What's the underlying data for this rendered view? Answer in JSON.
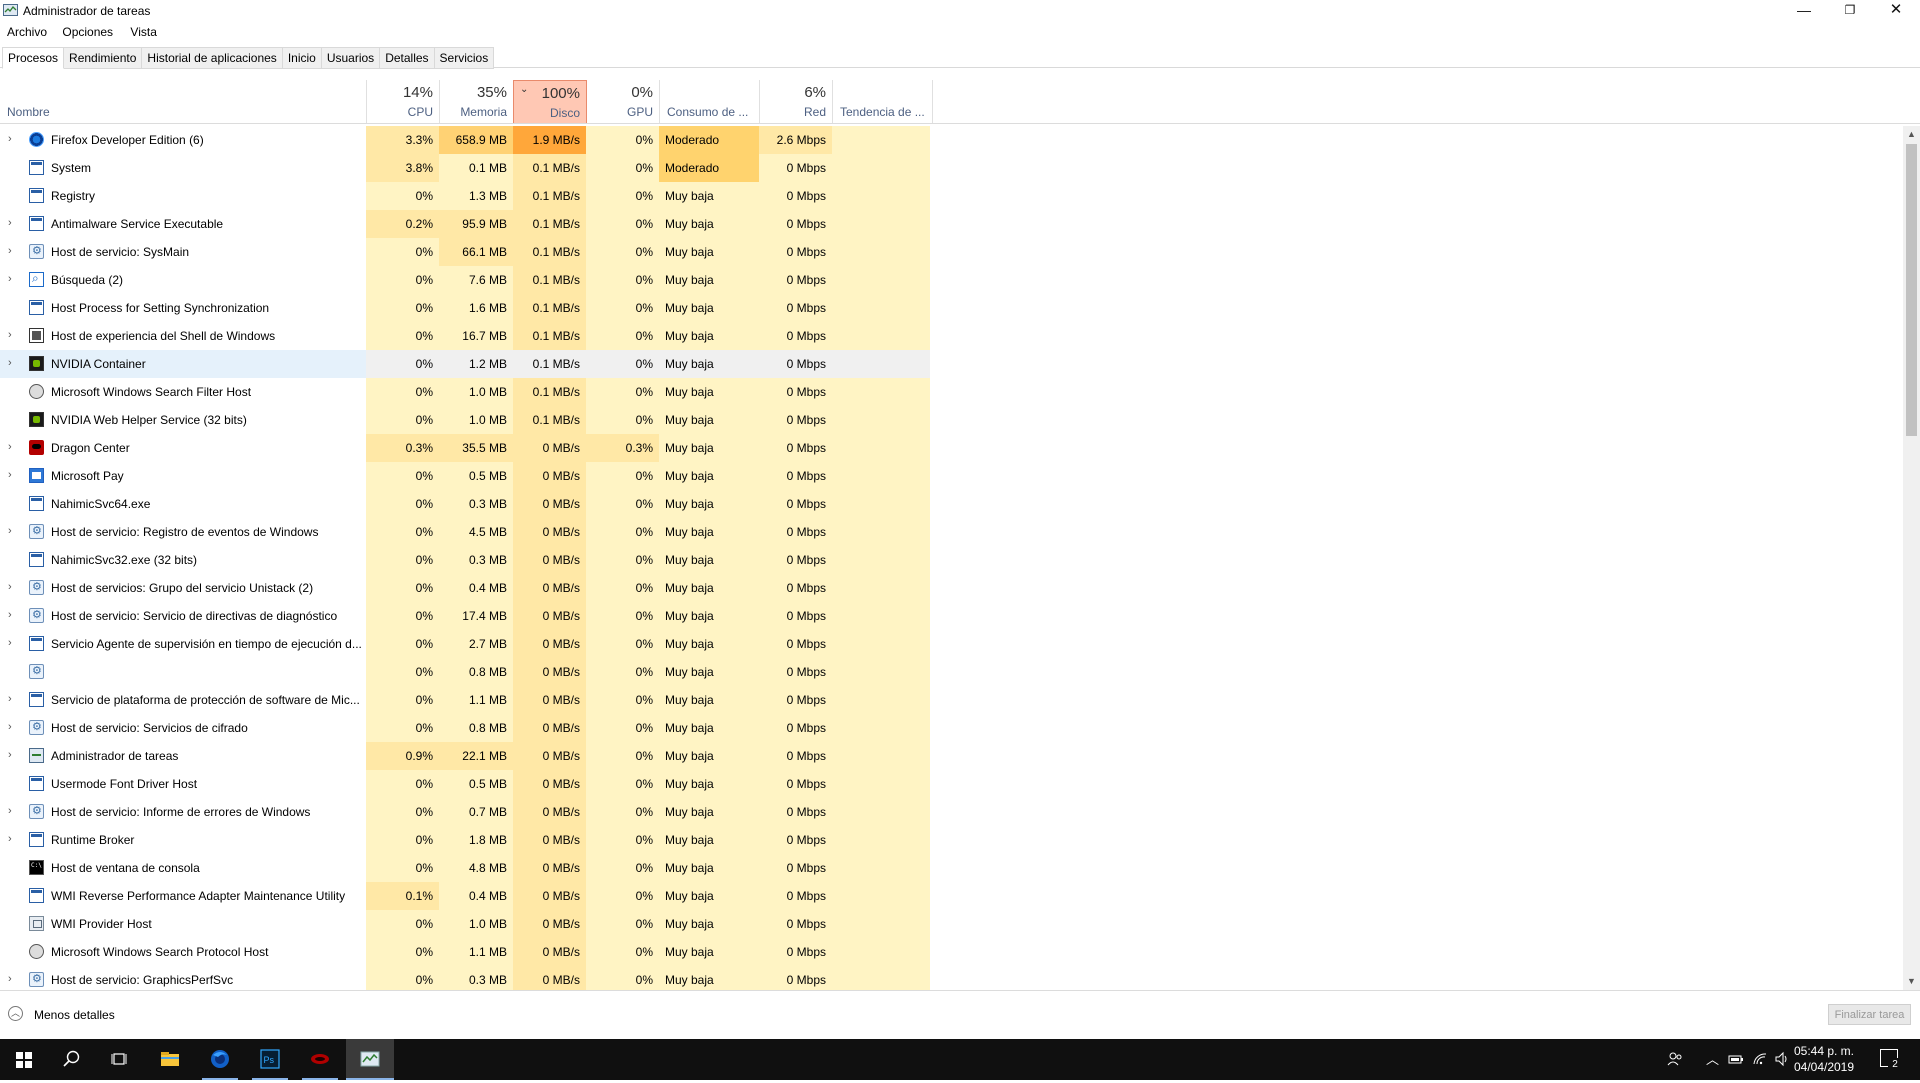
{
  "window": {
    "title": "Administrador de tareas",
    "min_glyph": "—",
    "max_glyph": "❐",
    "close_glyph": "✕"
  },
  "menu": [
    "Archivo",
    "Opciones",
    "Vista"
  ],
  "tabs": [
    "Procesos",
    "Rendimiento",
    "Historial de aplicaciones",
    "Inicio",
    "Usuarios",
    "Detalles",
    "Servicios"
  ],
  "active_tab": "Procesos",
  "columns": {
    "name": {
      "label": "Nombre"
    },
    "cpu": {
      "pct": "14%",
      "label": "CPU"
    },
    "memory": {
      "pct": "35%",
      "label": "Memoria"
    },
    "disk": {
      "pct": "100%",
      "label": "Disco",
      "sorted": "descending"
    },
    "gpu": {
      "pct": "0%",
      "label": "GPU"
    },
    "power": {
      "label": "Consumo de ..."
    },
    "network": {
      "pct": "6%",
      "label": "Red"
    },
    "trend": {
      "label": "Tendencia de ..."
    }
  },
  "processes": [
    {
      "name": "Firefox Developer Edition (6)",
      "icon": "firefox-icon",
      "expandable": true,
      "cpu": "3.3%",
      "mem": "658.9 MB",
      "disk": "1.9 MB/s",
      "gpu": "0%",
      "power": "Moderado",
      "net": "2.6 Mbps"
    },
    {
      "name": "System",
      "icon": "window-icon",
      "expandable": false,
      "cpu": "3.8%",
      "mem": "0.1 MB",
      "disk": "0.1 MB/s",
      "gpu": "0%",
      "power": "Moderado",
      "net": "0 Mbps"
    },
    {
      "name": "Registry",
      "icon": "window-icon",
      "expandable": false,
      "cpu": "0%",
      "mem": "1.3 MB",
      "disk": "0.1 MB/s",
      "gpu": "0%",
      "power": "Muy baja",
      "net": "0 Mbps"
    },
    {
      "name": "Antimalware Service Executable",
      "icon": "window-icon",
      "expandable": true,
      "cpu": "0.2%",
      "mem": "95.9 MB",
      "disk": "0.1 MB/s",
      "gpu": "0%",
      "power": "Muy baja",
      "net": "0 Mbps"
    },
    {
      "name": "Host de servicio: SysMain",
      "icon": "gear-icon",
      "expandable": true,
      "cpu": "0%",
      "mem": "66.1 MB",
      "disk": "0.1 MB/s",
      "gpu": "0%",
      "power": "Muy baja",
      "net": "0 Mbps"
    },
    {
      "name": "Búsqueda (2)",
      "icon": "search-icon",
      "expandable": true,
      "cpu": "0%",
      "mem": "7.6 MB",
      "disk": "0.1 MB/s",
      "gpu": "0%",
      "power": "Muy baja",
      "net": "0 Mbps"
    },
    {
      "name": "Host Process for Setting Synchronization",
      "icon": "window-icon",
      "expandable": false,
      "cpu": "0%",
      "mem": "1.6 MB",
      "disk": "0.1 MB/s",
      "gpu": "0%",
      "power": "Muy baja",
      "net": "0 Mbps"
    },
    {
      "name": "Host de experiencia del Shell de Windows",
      "icon": "shell-icon",
      "expandable": true,
      "cpu": "0%",
      "mem": "16.7 MB",
      "disk": "0.1 MB/s",
      "gpu": "0%",
      "power": "Muy baja",
      "net": "0 Mbps"
    },
    {
      "name": "NVIDIA Container",
      "icon": "nvidia-icon",
      "expandable": true,
      "selected": true,
      "cpu": "0%",
      "mem": "1.2 MB",
      "disk": "0.1 MB/s",
      "gpu": "0%",
      "power": "Muy baja",
      "net": "0 Mbps"
    },
    {
      "name": "Microsoft Windows Search Filter Host",
      "icon": "user-icon",
      "expandable": false,
      "cpu": "0%",
      "mem": "1.0 MB",
      "disk": "0.1 MB/s",
      "gpu": "0%",
      "power": "Muy baja",
      "net": "0 Mbps"
    },
    {
      "name": "NVIDIA Web Helper Service (32 bits)",
      "icon": "nvidia-icon",
      "expandable": false,
      "cpu": "0%",
      "mem": "1.0 MB",
      "disk": "0.1 MB/s",
      "gpu": "0%",
      "power": "Muy baja",
      "net": "0 Mbps"
    },
    {
      "name": "Dragon Center",
      "icon": "dragon-icon",
      "expandable": true,
      "cpu": "0.3%",
      "mem": "35.5 MB",
      "disk": "0 MB/s",
      "gpu": "0.3%",
      "power": "Muy baja",
      "net": "0 Mbps"
    },
    {
      "name": "Microsoft Pay",
      "icon": "pay-icon",
      "expandable": true,
      "cpu": "0%",
      "mem": "0.5 MB",
      "disk": "0 MB/s",
      "gpu": "0%",
      "power": "Muy baja",
      "net": "0 Mbps"
    },
    {
      "name": "NahimicSvc64.exe",
      "icon": "window-icon",
      "expandable": false,
      "cpu": "0%",
      "mem": "0.3 MB",
      "disk": "0 MB/s",
      "gpu": "0%",
      "power": "Muy baja",
      "net": "0 Mbps"
    },
    {
      "name": "Host de servicio: Registro de eventos de Windows",
      "icon": "gear-icon",
      "expandable": true,
      "cpu": "0%",
      "mem": "4.5 MB",
      "disk": "0 MB/s",
      "gpu": "0%",
      "power": "Muy baja",
      "net": "0 Mbps"
    },
    {
      "name": "NahimicSvc32.exe (32 bits)",
      "icon": "window-icon",
      "expandable": false,
      "cpu": "0%",
      "mem": "0.3 MB",
      "disk": "0 MB/s",
      "gpu": "0%",
      "power": "Muy baja",
      "net": "0 Mbps"
    },
    {
      "name": "Host de servicios: Grupo del servicio Unistack (2)",
      "icon": "gear-icon",
      "expandable": true,
      "cpu": "0%",
      "mem": "0.4 MB",
      "disk": "0 MB/s",
      "gpu": "0%",
      "power": "Muy baja",
      "net": "0 Mbps"
    },
    {
      "name": "Host de servicio: Servicio de directivas de diagnóstico",
      "icon": "gear-icon",
      "expandable": true,
      "cpu": "0%",
      "mem": "17.4 MB",
      "disk": "0 MB/s",
      "gpu": "0%",
      "power": "Muy baja",
      "net": "0 Mbps"
    },
    {
      "name": "Servicio Agente de supervisión en tiempo de ejecución d...",
      "icon": "window-icon",
      "expandable": true,
      "cpu": "0%",
      "mem": "2.7 MB",
      "disk": "0 MB/s",
      "gpu": "0%",
      "power": "Muy baja",
      "net": "0 Mbps"
    },
    {
      "name": "",
      "icon": "gear-icon",
      "expandable": false,
      "cpu": "0%",
      "mem": "0.8 MB",
      "disk": "0 MB/s",
      "gpu": "0%",
      "power": "Muy baja",
      "net": "0 Mbps"
    },
    {
      "name": "Servicio de plataforma de protección de software de Mic...",
      "icon": "window-icon",
      "expandable": true,
      "cpu": "0%",
      "mem": "1.1 MB",
      "disk": "0 MB/s",
      "gpu": "0%",
      "power": "Muy baja",
      "net": "0 Mbps"
    },
    {
      "name": "Host de servicio: Servicios de cifrado",
      "icon": "gear-icon",
      "expandable": true,
      "cpu": "0%",
      "mem": "0.8 MB",
      "disk": "0 MB/s",
      "gpu": "0%",
      "power": "Muy baja",
      "net": "0 Mbps"
    },
    {
      "name": "Administrador de tareas",
      "icon": "task-manager-icon",
      "expandable": true,
      "cpu": "0.9%",
      "mem": "22.1 MB",
      "disk": "0 MB/s",
      "gpu": "0%",
      "power": "Muy baja",
      "net": "0 Mbps"
    },
    {
      "name": "Usermode Font Driver Host",
      "icon": "window-icon",
      "expandable": false,
      "cpu": "0%",
      "mem": "0.5 MB",
      "disk": "0 MB/s",
      "gpu": "0%",
      "power": "Muy baja",
      "net": "0 Mbps"
    },
    {
      "name": "Host de servicio: Informe de errores de Windows",
      "icon": "gear-icon",
      "expandable": true,
      "cpu": "0%",
      "mem": "0.7 MB",
      "disk": "0 MB/s",
      "gpu": "0%",
      "power": "Muy baja",
      "net": "0 Mbps"
    },
    {
      "name": "Runtime Broker",
      "icon": "window-icon",
      "expandable": true,
      "cpu": "0%",
      "mem": "1.8 MB",
      "disk": "0 MB/s",
      "gpu": "0%",
      "power": "Muy baja",
      "net": "0 Mbps"
    },
    {
      "name": "Host de ventana de consola",
      "icon": "console-icon",
      "expandable": false,
      "cpu": "0%",
      "mem": "4.8 MB",
      "disk": "0 MB/s",
      "gpu": "0%",
      "power": "Muy baja",
      "net": "0 Mbps"
    },
    {
      "name": "WMI Reverse Performance Adapter Maintenance Utility",
      "icon": "window-icon",
      "expandable": false,
      "cpu": "0.1%",
      "mem": "0.4 MB",
      "disk": "0 MB/s",
      "gpu": "0%",
      "power": "Muy baja",
      "net": "0 Mbps"
    },
    {
      "name": "WMI Provider Host",
      "icon": "wmi-icon",
      "expandable": false,
      "cpu": "0%",
      "mem": "1.0 MB",
      "disk": "0 MB/s",
      "gpu": "0%",
      "power": "Muy baja",
      "net": "0 Mbps"
    },
    {
      "name": "Microsoft Windows Search Protocol Host",
      "icon": "user-icon",
      "expandable": false,
      "cpu": "0%",
      "mem": "1.1 MB",
      "disk": "0 MB/s",
      "gpu": "0%",
      "power": "Muy baja",
      "net": "0 Mbps"
    },
    {
      "name": "Host de servicio: GraphicsPerfSvc",
      "icon": "gear-icon",
      "expandable": true,
      "cpu": "0%",
      "mem": "0.3 MB",
      "disk": "0 MB/s",
      "gpu": "0%",
      "power": "Muy baja",
      "net": "0 Mbps"
    }
  ],
  "footer": {
    "less_details": "Menos detalles",
    "end_task": "Finalizar tarea"
  },
  "taskbar": {
    "items": [
      "search-icon",
      "task-view-icon",
      "file-explorer-icon",
      "firefox-icon",
      "photoshop-icon",
      "dragon-center-icon",
      "task-manager-icon"
    ],
    "time": "05:44 p. m.",
    "date": "04/04/2019",
    "notification_count": "2"
  },
  "colors": {
    "heat_low": "#fff4c4",
    "heat_mid": "#ffe8a6",
    "heat_high": "#ffd274",
    "heat_max": "#ffa73a",
    "sorted_header": "#ffc8b4",
    "selected_row": "#e5f1fb",
    "taskbar": "#101010"
  }
}
